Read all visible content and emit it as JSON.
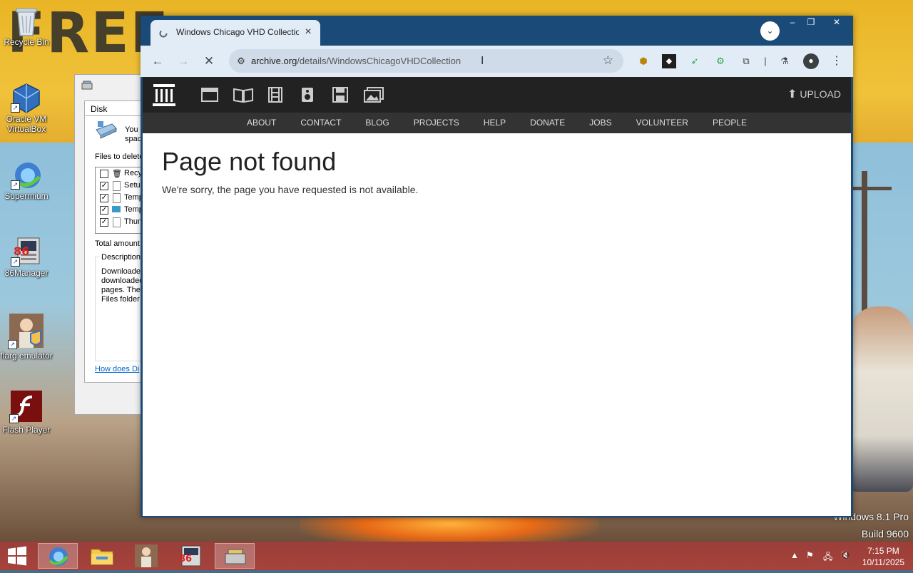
{
  "desktop": {
    "icons": [
      {
        "label": "Recycle Bin"
      },
      {
        "label": "Oracle VM VirtualBox"
      },
      {
        "label": "Supermium"
      },
      {
        "label": "86Manager"
      },
      {
        "label": "flarg emulator"
      },
      {
        "label": "Flash Player"
      }
    ],
    "watermark_line1": "Windows 8.1 Pro",
    "watermark_line2": "Build 9600"
  },
  "disk_cleanup": {
    "tab_label": "Disk Cleanup",
    "intro_line1": "You",
    "intro_line2": "spac",
    "files_to_delete_label": "Files to delete",
    "rows": [
      {
        "label": "Recy",
        "checked": false
      },
      {
        "label": "Setu",
        "checked": true
      },
      {
        "label": "Temp",
        "checked": true
      },
      {
        "label": "Temp",
        "checked": true
      },
      {
        "label": "Thum",
        "checked": true
      }
    ],
    "total_amount_label": "Total amount",
    "description_label": "Description",
    "description_lines": [
      "Downloade",
      "downloaded",
      "pages. The",
      "Files folder"
    ],
    "help_link": "How does Di"
  },
  "browser": {
    "tab_title": "Windows Chicago VHD Collection",
    "tab_close": "×",
    "new_tab": "+",
    "url_domain": "archive.org",
    "url_path": "/details/WindowsChicagoVHDCollection",
    "icons": {
      "back": "back-arrow-icon",
      "forward": "forward-arrow-icon",
      "stop": "stop-loading-icon",
      "site_info": "site-info-icon",
      "bookmark": "star-icon"
    }
  },
  "archive_page": {
    "upload_label": "UPLOAD",
    "nav": [
      "ABOUT",
      "CONTACT",
      "BLOG",
      "PROJECTS",
      "HELP",
      "DONATE",
      "JOBS",
      "VOLUNTEER",
      "PEOPLE"
    ],
    "title": "Page not found",
    "message": "We're sorry, the page you have requested is not available."
  },
  "taskbar": {
    "time": "7:15 PM",
    "date": "10/11/2025"
  },
  "colors": {
    "titlebar": "#1a4a78",
    "toolbar": "#e2ecf6",
    "taskbar": "#a0403b",
    "archive_header": "#222222"
  }
}
